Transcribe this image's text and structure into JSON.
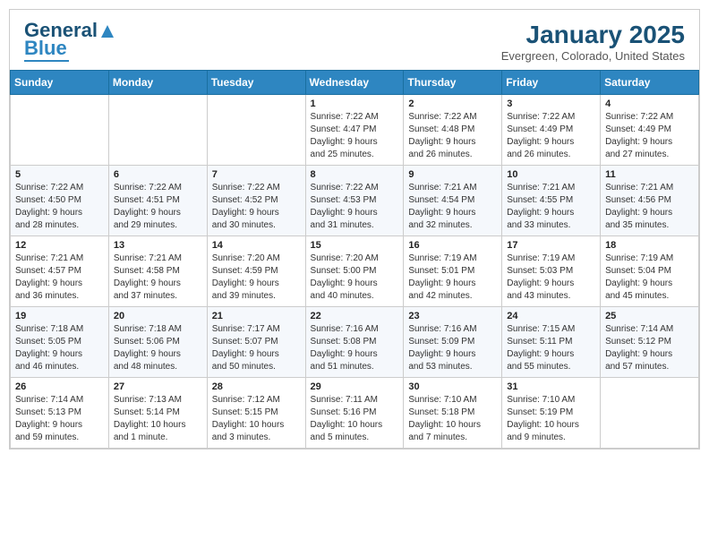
{
  "header": {
    "logo_line1": "General",
    "logo_line2": "Blue",
    "title": "January 2025",
    "subtitle": "Evergreen, Colorado, United States"
  },
  "calendar": {
    "days_of_week": [
      "Sunday",
      "Monday",
      "Tuesday",
      "Wednesday",
      "Thursday",
      "Friday",
      "Saturday"
    ],
    "weeks": [
      [
        {
          "day": "",
          "info": ""
        },
        {
          "day": "",
          "info": ""
        },
        {
          "day": "",
          "info": ""
        },
        {
          "day": "1",
          "info": "Sunrise: 7:22 AM\nSunset: 4:47 PM\nDaylight: 9 hours\nand 25 minutes."
        },
        {
          "day": "2",
          "info": "Sunrise: 7:22 AM\nSunset: 4:48 PM\nDaylight: 9 hours\nand 26 minutes."
        },
        {
          "day": "3",
          "info": "Sunrise: 7:22 AM\nSunset: 4:49 PM\nDaylight: 9 hours\nand 26 minutes."
        },
        {
          "day": "4",
          "info": "Sunrise: 7:22 AM\nSunset: 4:49 PM\nDaylight: 9 hours\nand 27 minutes."
        }
      ],
      [
        {
          "day": "5",
          "info": "Sunrise: 7:22 AM\nSunset: 4:50 PM\nDaylight: 9 hours\nand 28 minutes."
        },
        {
          "day": "6",
          "info": "Sunrise: 7:22 AM\nSunset: 4:51 PM\nDaylight: 9 hours\nand 29 minutes."
        },
        {
          "day": "7",
          "info": "Sunrise: 7:22 AM\nSunset: 4:52 PM\nDaylight: 9 hours\nand 30 minutes."
        },
        {
          "day": "8",
          "info": "Sunrise: 7:22 AM\nSunset: 4:53 PM\nDaylight: 9 hours\nand 31 minutes."
        },
        {
          "day": "9",
          "info": "Sunrise: 7:21 AM\nSunset: 4:54 PM\nDaylight: 9 hours\nand 32 minutes."
        },
        {
          "day": "10",
          "info": "Sunrise: 7:21 AM\nSunset: 4:55 PM\nDaylight: 9 hours\nand 33 minutes."
        },
        {
          "day": "11",
          "info": "Sunrise: 7:21 AM\nSunset: 4:56 PM\nDaylight: 9 hours\nand 35 minutes."
        }
      ],
      [
        {
          "day": "12",
          "info": "Sunrise: 7:21 AM\nSunset: 4:57 PM\nDaylight: 9 hours\nand 36 minutes."
        },
        {
          "day": "13",
          "info": "Sunrise: 7:21 AM\nSunset: 4:58 PM\nDaylight: 9 hours\nand 37 minutes."
        },
        {
          "day": "14",
          "info": "Sunrise: 7:20 AM\nSunset: 4:59 PM\nDaylight: 9 hours\nand 39 minutes."
        },
        {
          "day": "15",
          "info": "Sunrise: 7:20 AM\nSunset: 5:00 PM\nDaylight: 9 hours\nand 40 minutes."
        },
        {
          "day": "16",
          "info": "Sunrise: 7:19 AM\nSunset: 5:01 PM\nDaylight: 9 hours\nand 42 minutes."
        },
        {
          "day": "17",
          "info": "Sunrise: 7:19 AM\nSunset: 5:03 PM\nDaylight: 9 hours\nand 43 minutes."
        },
        {
          "day": "18",
          "info": "Sunrise: 7:19 AM\nSunset: 5:04 PM\nDaylight: 9 hours\nand 45 minutes."
        }
      ],
      [
        {
          "day": "19",
          "info": "Sunrise: 7:18 AM\nSunset: 5:05 PM\nDaylight: 9 hours\nand 46 minutes."
        },
        {
          "day": "20",
          "info": "Sunrise: 7:18 AM\nSunset: 5:06 PM\nDaylight: 9 hours\nand 48 minutes."
        },
        {
          "day": "21",
          "info": "Sunrise: 7:17 AM\nSunset: 5:07 PM\nDaylight: 9 hours\nand 50 minutes."
        },
        {
          "day": "22",
          "info": "Sunrise: 7:16 AM\nSunset: 5:08 PM\nDaylight: 9 hours\nand 51 minutes."
        },
        {
          "day": "23",
          "info": "Sunrise: 7:16 AM\nSunset: 5:09 PM\nDaylight: 9 hours\nand 53 minutes."
        },
        {
          "day": "24",
          "info": "Sunrise: 7:15 AM\nSunset: 5:11 PM\nDaylight: 9 hours\nand 55 minutes."
        },
        {
          "day": "25",
          "info": "Sunrise: 7:14 AM\nSunset: 5:12 PM\nDaylight: 9 hours\nand 57 minutes."
        }
      ],
      [
        {
          "day": "26",
          "info": "Sunrise: 7:14 AM\nSunset: 5:13 PM\nDaylight: 9 hours\nand 59 minutes."
        },
        {
          "day": "27",
          "info": "Sunrise: 7:13 AM\nSunset: 5:14 PM\nDaylight: 10 hours\nand 1 minute."
        },
        {
          "day": "28",
          "info": "Sunrise: 7:12 AM\nSunset: 5:15 PM\nDaylight: 10 hours\nand 3 minutes."
        },
        {
          "day": "29",
          "info": "Sunrise: 7:11 AM\nSunset: 5:16 PM\nDaylight: 10 hours\nand 5 minutes."
        },
        {
          "day": "30",
          "info": "Sunrise: 7:10 AM\nSunset: 5:18 PM\nDaylight: 10 hours\nand 7 minutes."
        },
        {
          "day": "31",
          "info": "Sunrise: 7:10 AM\nSunset: 5:19 PM\nDaylight: 10 hours\nand 9 minutes."
        },
        {
          "day": "",
          "info": ""
        }
      ]
    ]
  }
}
